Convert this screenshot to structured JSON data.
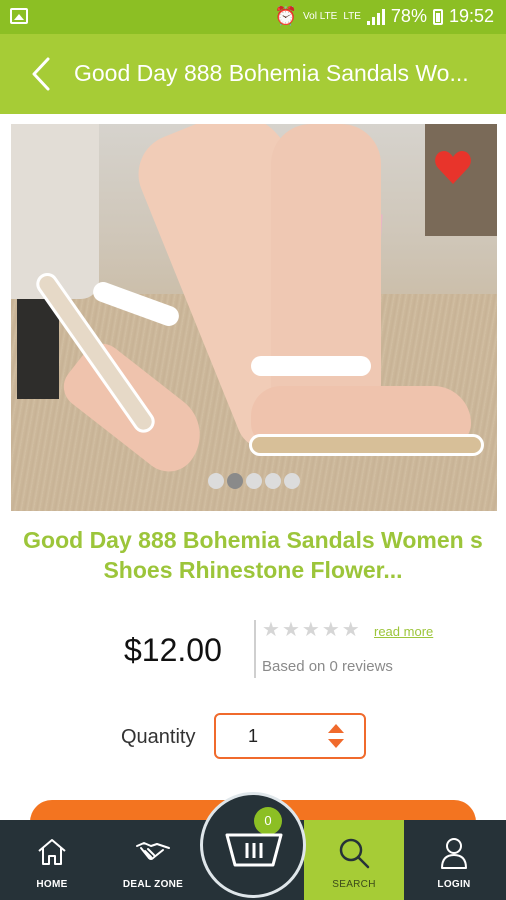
{
  "status_bar": {
    "volte": "Vol LTE",
    "lte": "LTE",
    "battery_percent": "78%",
    "time": "19:52"
  },
  "app_bar": {
    "title": "Good Day 888 Bohemia Sandals Wo..."
  },
  "gallery": {
    "image_count": 5,
    "active_index": 1,
    "favorite": true
  },
  "product": {
    "title": "Good Day 888 Bohemia Sandals Women s Shoes Rhinestone Flower...",
    "price": "$12.00",
    "rating": 0,
    "max_rating": 5,
    "read_more": "read more",
    "reviews": "Based on 0 reviews"
  },
  "quantity": {
    "label": "Quantity",
    "value": "1"
  },
  "cart": {
    "count": "0"
  },
  "bottom_nav": {
    "items": [
      {
        "label": "HOME",
        "icon": "home-icon",
        "active": false
      },
      {
        "label": "DEAL ZONE",
        "icon": "handshake-icon",
        "active": false
      },
      {
        "label": "SEARCH",
        "icon": "search-icon",
        "active": true
      },
      {
        "label": "LOGIN",
        "icon": "user-icon",
        "active": false
      }
    ]
  },
  "colors": {
    "brand_green": "#a6cc36",
    "status_green": "#8cbf24",
    "accent_orange": "#f06a2c",
    "nav_dark": "#263238",
    "favorite_red": "#e8342b"
  }
}
